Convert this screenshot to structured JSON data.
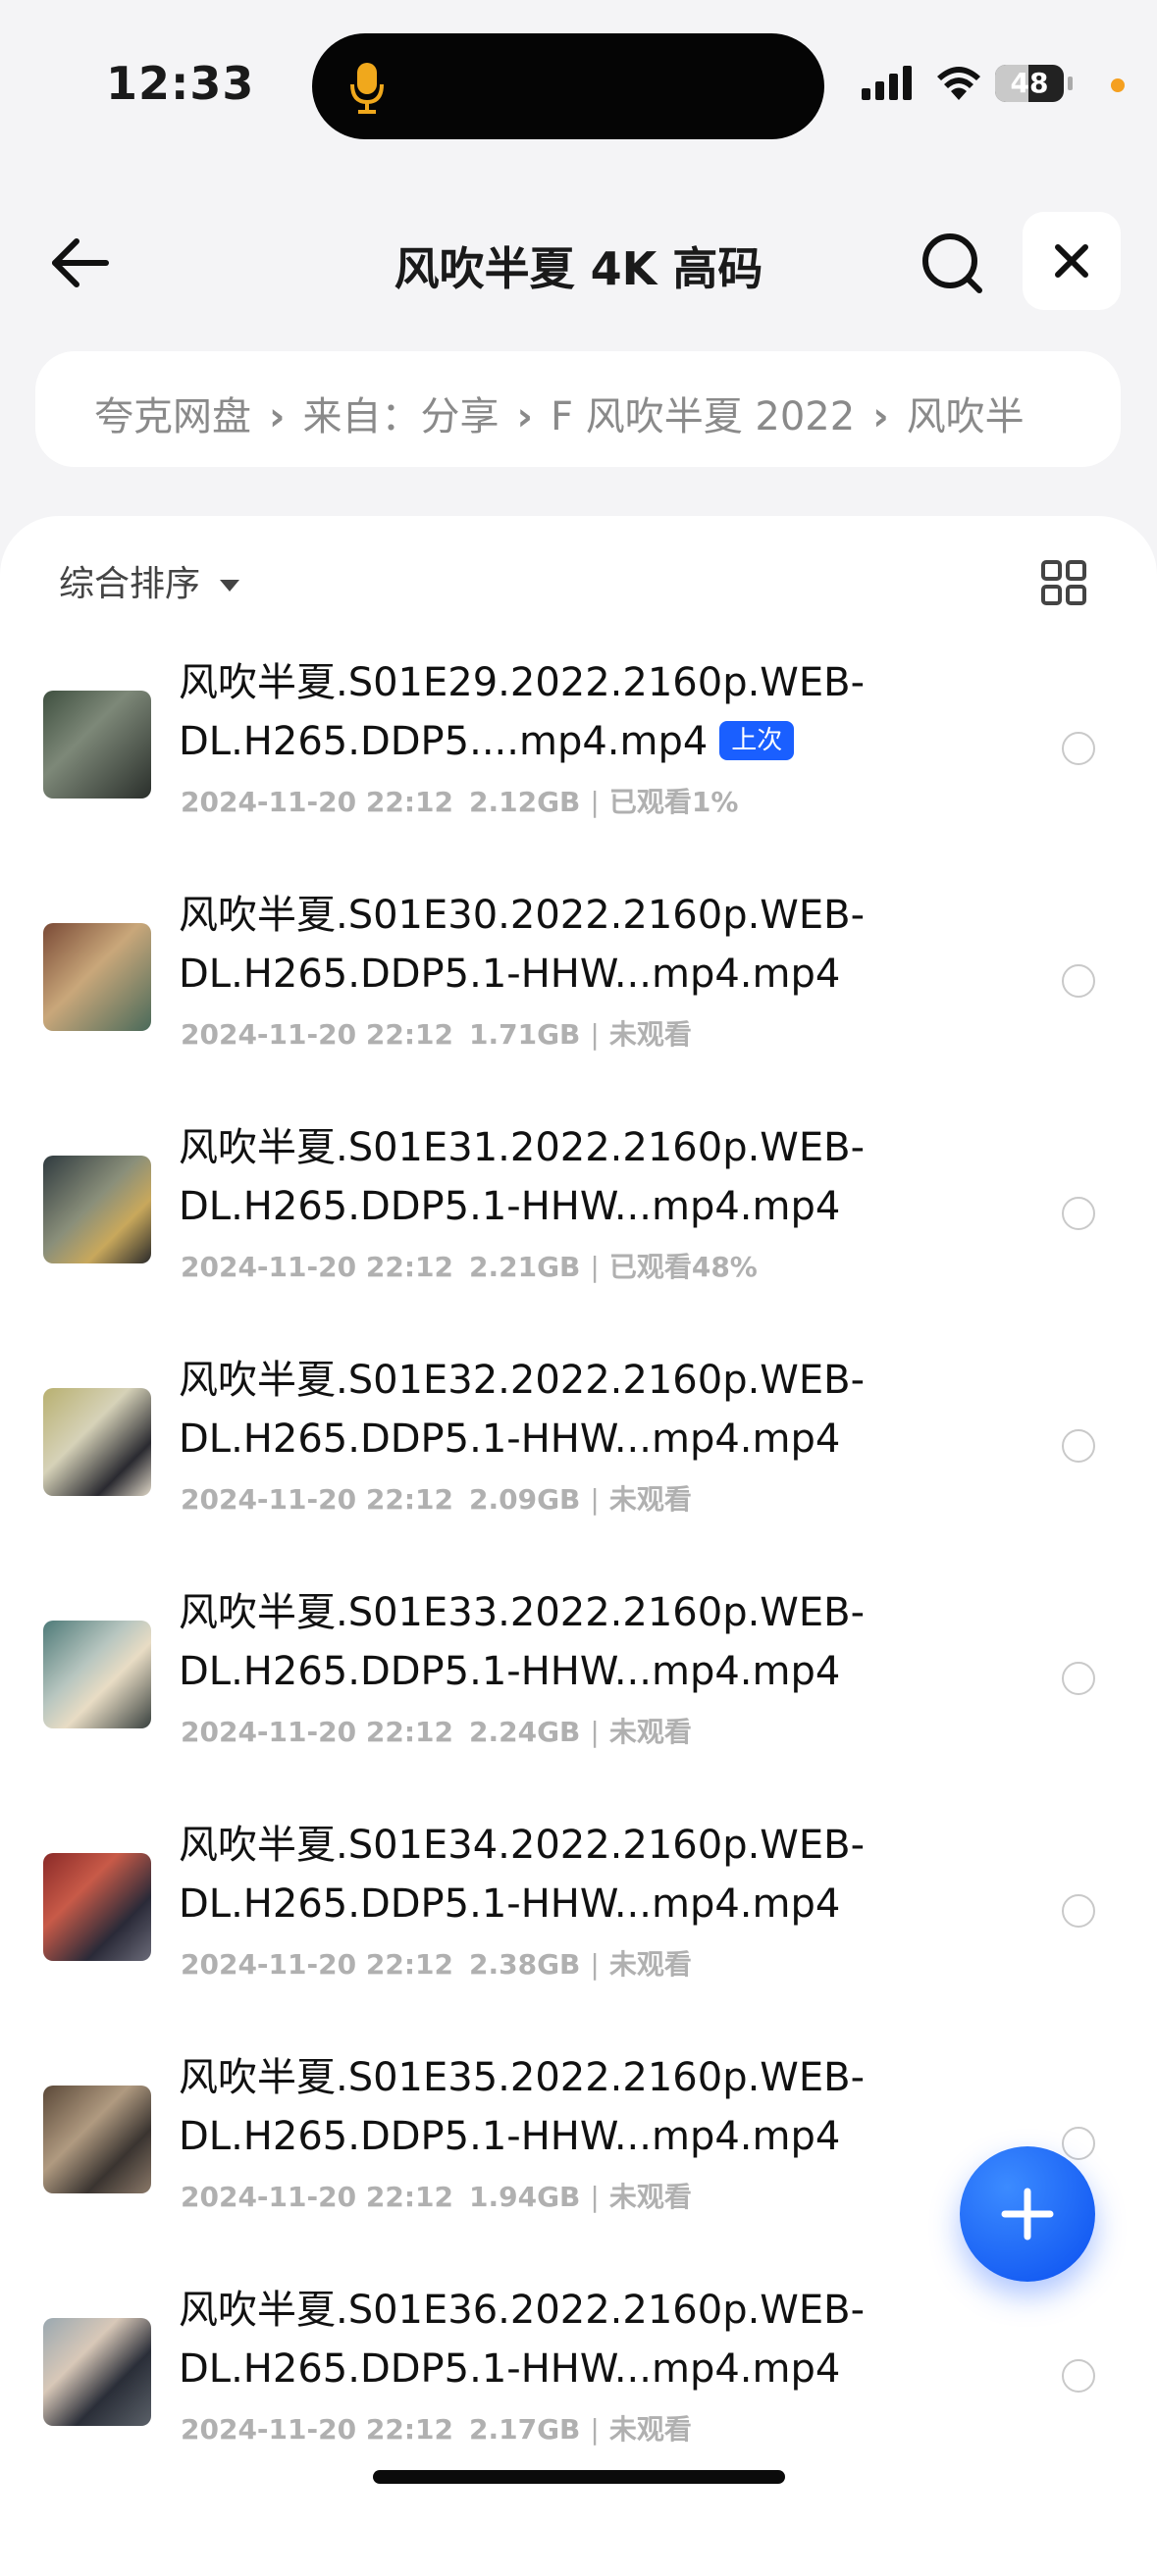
{
  "status_bar": {
    "time": "12:33",
    "battery": "48",
    "battery_level": 0.48
  },
  "header": {
    "title": "风吹半夏 4K 高码"
  },
  "breadcrumb": [
    "夸克网盘",
    "来自：分享",
    "F 风吹半夏 2022",
    "风吹半"
  ],
  "toolbar": {
    "sort_label": "综合排序"
  },
  "files": [
    {
      "name": "风吹半夏.S01E29.2022.2160p.WEB-DL.H265.DDP5....mp4.mp4",
      "tag": "上次",
      "date": "2024-11-20 22:12",
      "size": "2.12GB",
      "status": "已观看1%"
    },
    {
      "name": "风吹半夏.S01E30.2022.2160p.WEB-DL.H265.DDP5.1-HHW...mp4.mp4",
      "tag": "",
      "date": "2024-11-20 22:12",
      "size": "1.71GB",
      "status": "未观看"
    },
    {
      "name": "风吹半夏.S01E31.2022.2160p.WEB-DL.H265.DDP5.1-HHW...mp4.mp4",
      "tag": "",
      "date": "2024-11-20 22:12",
      "size": "2.21GB",
      "status": "已观看48%"
    },
    {
      "name": "风吹半夏.S01E32.2022.2160p.WEB-DL.H265.DDP5.1-HHW...mp4.mp4",
      "tag": "",
      "date": "2024-11-20 22:12",
      "size": "2.09GB",
      "status": "未观看"
    },
    {
      "name": "风吹半夏.S01E33.2022.2160p.WEB-DL.H265.DDP5.1-HHW...mp4.mp4",
      "tag": "",
      "date": "2024-11-20 22:12",
      "size": "2.24GB",
      "status": "未观看"
    },
    {
      "name": "风吹半夏.S01E34.2022.2160p.WEB-DL.H265.DDP5.1-HHW...mp4.mp4",
      "tag": "",
      "date": "2024-11-20 22:12",
      "size": "2.38GB",
      "status": "未观看"
    },
    {
      "name": "风吹半夏.S01E35.2022.2160p.WEB-DL.H265.DDP5.1-HHW...mp4.mp4",
      "tag": "",
      "date": "2024-11-20 22:12",
      "size": "1.94GB",
      "status": "未观看"
    },
    {
      "name": "风吹半夏.S01E36.2022.2160p.WEB-DL.H265.DDP5.1-HHW...mp4.mp4",
      "tag": "",
      "date": "2024-11-20 22:12",
      "size": "2.17GB",
      "status": "未观看"
    }
  ],
  "colors": {
    "accent": "#1a5fff",
    "meta": "#b0b0b0",
    "dot": "#f5a020"
  }
}
